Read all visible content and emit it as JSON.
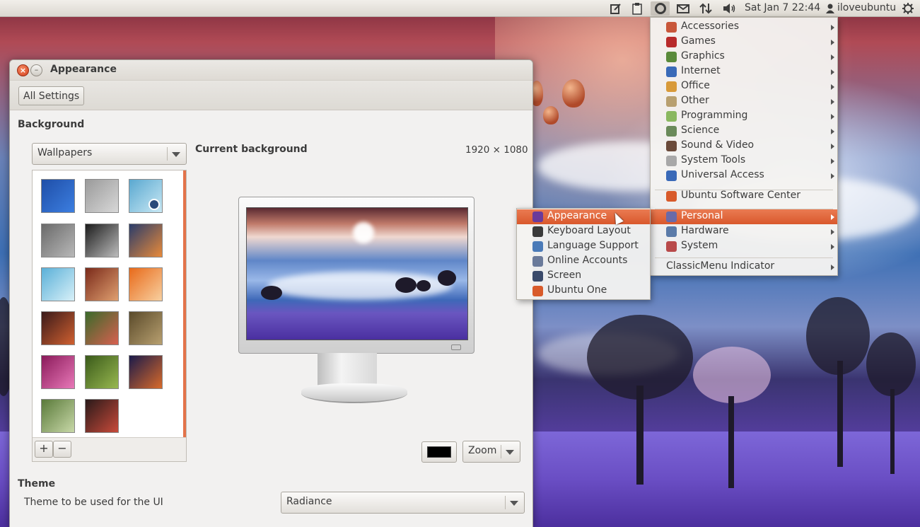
{
  "top_panel": {
    "datetime": "Sat Jan  7 22:44",
    "user": "iloveubuntu",
    "icons": [
      "notes-icon",
      "clipboard-icon",
      "ubuntu-menu-icon",
      "mail-icon",
      "network-icon",
      "volume-icon",
      "user-icon",
      "power-icon"
    ]
  },
  "window": {
    "title": "Appearance",
    "all_settings": "All Settings",
    "background_label": "Background",
    "source_combo": "Wallpapers",
    "current_background_label": "Current background",
    "resolution": "1920 × 1080",
    "add_label": "+",
    "remove_label": "−",
    "zoom_combo": "Zoom",
    "swatch_color": "#000000",
    "theme_label": "Theme",
    "theme_desc": "Theme to be used for the UI",
    "theme_combo": "Radiance",
    "thumbnails": [
      {
        "c1": "#1f4fa8",
        "c2": "#3c7ee0"
      },
      {
        "c1": "#9a9a9a",
        "c2": "#d8d8d8"
      },
      {
        "c1": "#5aa8d0",
        "c2": "#c8e8f4"
      },
      {
        "c1": "#6a6a6a",
        "c2": "#b8b8b8"
      },
      {
        "c1": "#1c1c1c",
        "c2": "#bcbcbc"
      },
      {
        "c1": "#2a3c6a",
        "c2": "#e88a3a"
      },
      {
        "c1": "#5ab0d8",
        "c2": "#d8f0f8"
      },
      {
        "c1": "#7a2a1a",
        "c2": "#e0a070"
      },
      {
        "c1": "#e86a1a",
        "c2": "#f8d0a0"
      },
      {
        "c1": "#3a1a1a",
        "c2": "#d06030"
      },
      {
        "c1": "#3a6a2a",
        "c2": "#d86050"
      },
      {
        "c1": "#5a4a2a",
        "c2": "#b8a070"
      },
      {
        "c1": "#8a1a5a",
        "c2": "#e878b8"
      },
      {
        "c1": "#3a5a1a",
        "c2": "#98b850"
      },
      {
        "c1": "#1a1a4a",
        "c2": "#d86a2a"
      },
      {
        "c1": "#5a7a3a",
        "c2": "#c8d8a8"
      },
      {
        "c1": "#2a1a1a",
        "c2": "#c84a3a"
      }
    ]
  },
  "main_menu": {
    "items": [
      {
        "label": "Accessories",
        "icon": "#c8563a"
      },
      {
        "label": "Games",
        "icon": "#b82a2a"
      },
      {
        "label": "Graphics",
        "icon": "#5a8a3a"
      },
      {
        "label": "Internet",
        "icon": "#3a6ab8"
      },
      {
        "label": "Office",
        "icon": "#d89a3a"
      },
      {
        "label": "Other",
        "icon": "#b8a070"
      },
      {
        "label": "Programming",
        "icon": "#8ab860"
      },
      {
        "label": "Science",
        "icon": "#6a8a5a"
      },
      {
        "label": "Sound & Video",
        "icon": "#6a4a3a"
      },
      {
        "label": "System Tools",
        "icon": "#a8a8a8"
      },
      {
        "label": "Universal Access",
        "icon": "#3a6ab8"
      }
    ],
    "software_center": {
      "label": "Ubuntu Software Center",
      "icon": "#d85a2a"
    },
    "settings_items": [
      {
        "label": "Personal",
        "icon": "#6a6aa8"
      },
      {
        "label": "Hardware",
        "icon": "#5a7aa8"
      },
      {
        "label": "System",
        "icon": "#b84a4a"
      }
    ],
    "classicmenu": "ClassicMenu Indicator"
  },
  "personal_menu": {
    "items": [
      {
        "label": "Appearance",
        "icon": "#6a3a9a"
      },
      {
        "label": "Keyboard Layout",
        "icon": "#3a3a3a"
      },
      {
        "label": "Language Support",
        "icon": "#4a7ab8"
      },
      {
        "label": "Online Accounts",
        "icon": "#6a7a9a"
      },
      {
        "label": "Screen",
        "icon": "#3a4a6a"
      },
      {
        "label": "Ubuntu One",
        "icon": "#d85a2a"
      }
    ]
  }
}
